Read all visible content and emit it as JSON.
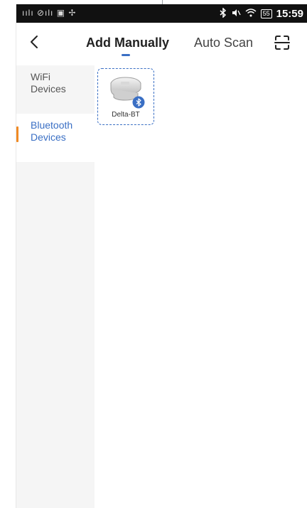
{
  "status_bar": {
    "left_icons": "ıılı ⊘ılı ▣ ✢",
    "right_icons": [
      "bluetooth-icon",
      "mute-icon",
      "wifi-icon"
    ],
    "battery": "55",
    "time": "15:59"
  },
  "header": {
    "back_icon": "chevron-left-icon",
    "tab_add_manually": "Add Manually",
    "tab_auto_scan": "Auto Scan",
    "scan_icon": "scan-frame-icon",
    "active_color": "#3a6fc4"
  },
  "sidebar": {
    "items": [
      {
        "line1": "WiFi",
        "line2": "Devices",
        "active": false
      },
      {
        "line1": "Bluetooth",
        "line2": "Devices",
        "active": true
      }
    ],
    "indicator_color": "#f08a24"
  },
  "devices": [
    {
      "label": "Delta-BT",
      "badge_icon": "bluetooth-badge-icon"
    }
  ]
}
